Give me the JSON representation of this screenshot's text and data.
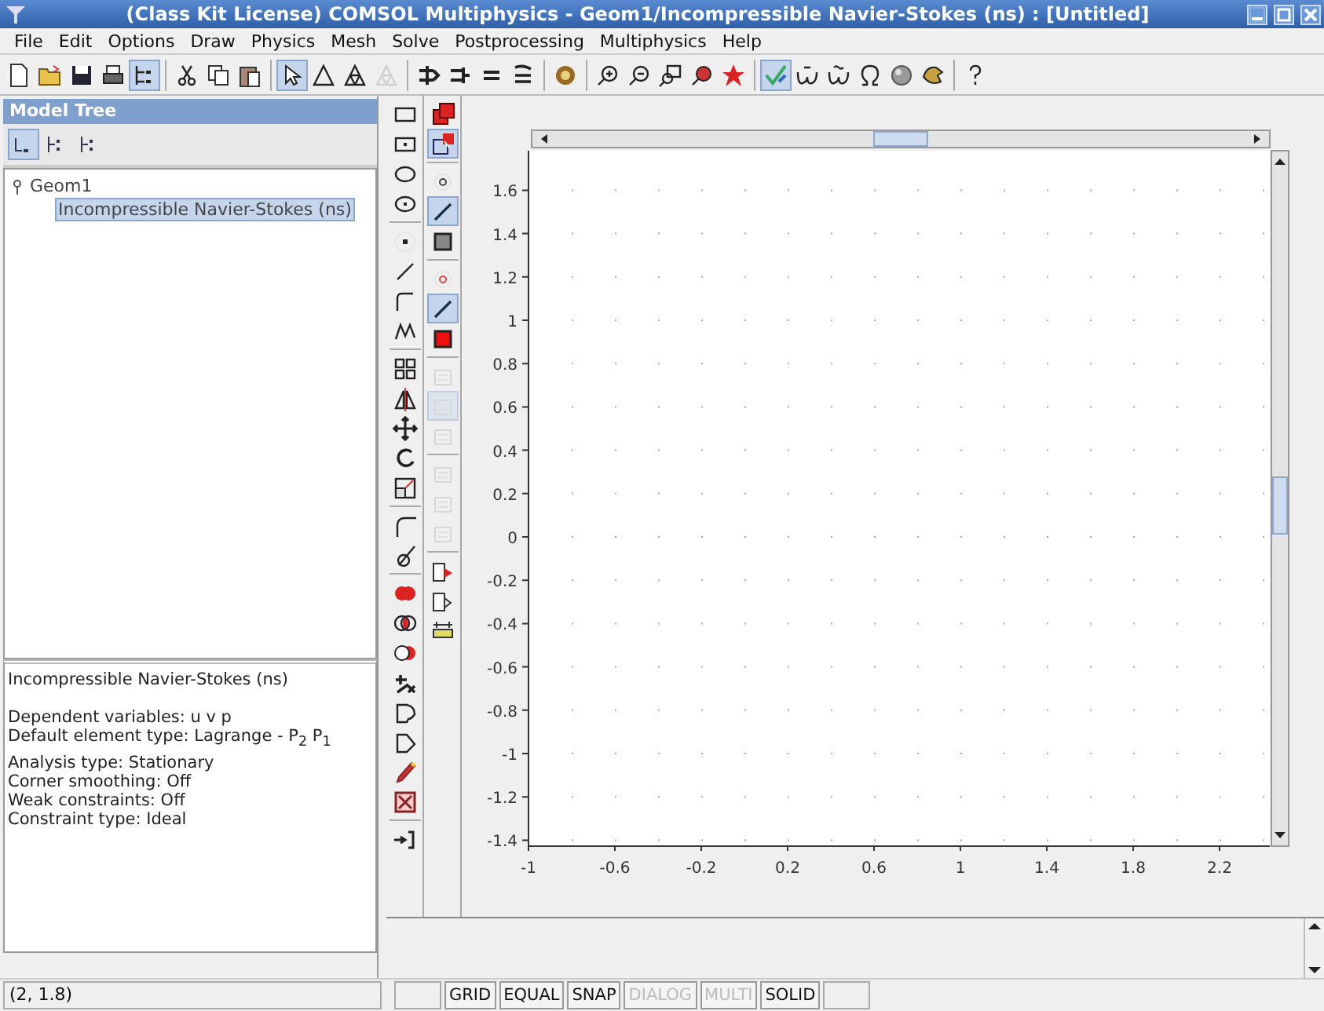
{
  "window": {
    "title": "(Class Kit License) COMSOL Multiphysics - Geom1/Incompressible Navier-Stokes (ns) : [Untitled]"
  },
  "menu": [
    "File",
    "Edit",
    "Options",
    "Draw",
    "Physics",
    "Mesh",
    "Solve",
    "Postprocessing",
    "Multiphysics",
    "Help"
  ],
  "toolbar": [
    {
      "kind": "button",
      "selected": false,
      "disabled": false
    },
    {
      "kind": "button",
      "selected": false,
      "disabled": false
    },
    {
      "kind": "button",
      "selected": false,
      "disabled": false
    },
    {
      "kind": "button",
      "selected": false,
      "disabled": false
    },
    {
      "kind": "button",
      "selected": true,
      "disabled": false
    },
    {
      "kind": "separator"
    },
    {
      "kind": "button",
      "selected": false,
      "disabled": false
    },
    {
      "kind": "button",
      "selected": false,
      "disabled": false
    },
    {
      "kind": "button",
      "selected": false,
      "disabled": false
    },
    {
      "kind": "separator"
    },
    {
      "kind": "button",
      "selected": true,
      "disabled": false
    },
    {
      "kind": "button",
      "selected": false,
      "disabled": false
    },
    {
      "kind": "button",
      "selected": false,
      "disabled": false
    },
    {
      "kind": "button",
      "selected": false,
      "disabled": true
    },
    {
      "kind": "separator"
    },
    {
      "kind": "button",
      "selected": false,
      "disabled": false
    },
    {
      "kind": "button",
      "selected": false,
      "disabled": false
    },
    {
      "kind": "button",
      "selected": false,
      "disabled": false
    },
    {
      "kind": "button",
      "selected": false,
      "disabled": false
    },
    {
      "kind": "separator"
    },
    {
      "kind": "button",
      "selected": false,
      "disabled": false
    },
    {
      "kind": "separator"
    },
    {
      "kind": "button",
      "selected": false,
      "disabled": false
    },
    {
      "kind": "button",
      "selected": false,
      "disabled": false
    },
    {
      "kind": "button",
      "selected": false,
      "disabled": false
    },
    {
      "kind": "button",
      "selected": false,
      "disabled": false
    },
    {
      "kind": "button",
      "selected": false,
      "disabled": false
    },
    {
      "kind": "separator"
    },
    {
      "kind": "button",
      "selected": true,
      "disabled": false
    },
    {
      "kind": "button",
      "selected": false,
      "disabled": false
    },
    {
      "kind": "button",
      "selected": false,
      "disabled": false
    },
    {
      "kind": "button",
      "selected": false,
      "disabled": false
    },
    {
      "kind": "button",
      "selected": false,
      "disabled": false
    },
    {
      "kind": "button",
      "selected": false,
      "disabled": false
    },
    {
      "kind": "separator"
    },
    {
      "kind": "button",
      "selected": false,
      "disabled": false
    }
  ],
  "model_tree": {
    "title": "Model Tree",
    "view_buttons": [
      {
        "selected": true
      },
      {
        "selected": false
      },
      {
        "selected": false
      }
    ],
    "nodes": [
      {
        "label": "Geom1",
        "expanded": true,
        "selected": false,
        "children": [
          {
            "label": "Incompressible Navier-Stokes (ns)",
            "selected": true
          }
        ]
      }
    ]
  },
  "info": {
    "title": "Incompressible Navier-Stokes (ns)",
    "groups": [
      [
        "Dependent variables: u v p",
        "Default element type: Lagrange - P$_{2}$ P$_{1}$"
      ],
      [
        "Analysis type: Stationary",
        "Corner smoothing: Off",
        "Weak constraints: Off",
        "Constraint type: Ideal"
      ]
    ]
  },
  "draw_toolbar": [
    {
      "kind": "button",
      "selected": false,
      "disabled": false
    },
    {
      "kind": "button",
      "selected": false,
      "disabled": false
    },
    {
      "kind": "button",
      "selected": false,
      "disabled": false
    },
    {
      "kind": "button",
      "selected": false,
      "disabled": false
    },
    {
      "kind": "separator"
    },
    {
      "kind": "button",
      "selected": false,
      "disabled": false
    },
    {
      "kind": "button",
      "selected": false,
      "disabled": false
    },
    {
      "kind": "button",
      "selected": false,
      "disabled": false
    },
    {
      "kind": "button",
      "selected": false,
      "disabled": false
    },
    {
      "kind": "separator"
    },
    {
      "kind": "button",
      "selected": false,
      "disabled": false
    },
    {
      "kind": "button",
      "selected": false,
      "disabled": false
    },
    {
      "kind": "button",
      "selected": false,
      "disabled": false
    },
    {
      "kind": "button",
      "selected": false,
      "disabled": false
    },
    {
      "kind": "button",
      "selected": false,
      "disabled": false
    },
    {
      "kind": "separator"
    },
    {
      "kind": "button",
      "selected": false,
      "disabled": false
    },
    {
      "kind": "button",
      "selected": false,
      "disabled": false
    },
    {
      "kind": "separator"
    },
    {
      "kind": "button",
      "selected": false,
      "disabled": false
    },
    {
      "kind": "button",
      "selected": false,
      "disabled": false
    },
    {
      "kind": "button",
      "selected": false,
      "disabled": false
    },
    {
      "kind": "button",
      "selected": false,
      "disabled": false
    },
    {
      "kind": "button",
      "selected": false,
      "disabled": false
    },
    {
      "kind": "button",
      "selected": false,
      "disabled": false
    },
    {
      "kind": "button",
      "selected": false,
      "disabled": false
    },
    {
      "kind": "button",
      "selected": false,
      "disabled": false
    },
    {
      "kind": "separator"
    },
    {
      "kind": "button",
      "selected": false,
      "disabled": false
    }
  ],
  "mode_toolbar": [
    {
      "kind": "button",
      "selected": false,
      "disabled": false
    },
    {
      "kind": "button",
      "selected": true,
      "disabled": false
    },
    {
      "kind": "separator"
    },
    {
      "kind": "button",
      "selected": false,
      "disabled": false
    },
    {
      "kind": "button",
      "selected": true,
      "disabled": false
    },
    {
      "kind": "button",
      "selected": false,
      "disabled": false
    },
    {
      "kind": "separator"
    },
    {
      "kind": "button",
      "selected": false,
      "disabled": false
    },
    {
      "kind": "button",
      "selected": true,
      "disabled": false
    },
    {
      "kind": "button",
      "selected": false,
      "disabled": false
    },
    {
      "kind": "separator"
    },
    {
      "kind": "button",
      "selected": false,
      "disabled": true
    },
    {
      "kind": "button",
      "selected": true,
      "disabled": true
    },
    {
      "kind": "button",
      "selected": false,
      "disabled": true
    },
    {
      "kind": "separator"
    },
    {
      "kind": "button",
      "selected": false,
      "disabled": true
    },
    {
      "kind": "button",
      "selected": false,
      "disabled": true
    },
    {
      "kind": "button",
      "selected": false,
      "disabled": true
    },
    {
      "kind": "separator"
    },
    {
      "kind": "button",
      "selected": false,
      "disabled": false
    },
    {
      "kind": "button",
      "selected": false,
      "disabled": false
    },
    {
      "kind": "button",
      "selected": false,
      "disabled": false
    }
  ],
  "plot": {
    "y_ticks": [
      "1.6",
      "1.4",
      "1.2",
      "1",
      "0.8",
      "0.6",
      "0.4",
      "0.2",
      "0",
      "-0.2",
      "-0.4",
      "-0.6",
      "-0.8",
      "-1",
      "-1.2",
      "-1.4"
    ],
    "x_ticks": [
      "-1",
      "-0.6",
      "-0.2",
      "0.2",
      "0.6",
      "1",
      "1.4",
      "1.8",
      "2.2"
    ]
  },
  "status_bar": {
    "coordinates": "(2, 1.8)",
    "toggles": [
      {
        "label": "GRID",
        "disabled": false
      },
      {
        "label": "EQUAL",
        "disabled": false
      },
      {
        "label": "SNAP",
        "disabled": false
      },
      {
        "label": "DIALOG",
        "disabled": true
      },
      {
        "label": "MULTI",
        "disabled": true
      },
      {
        "label": "SOLID",
        "disabled": false
      }
    ]
  }
}
